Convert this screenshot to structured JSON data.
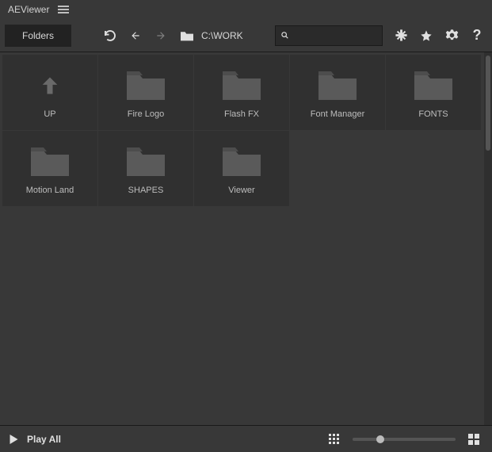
{
  "title": "AEViewer",
  "toolbar": {
    "folders_label": "Folders",
    "path": "C:\\WORK",
    "search_placeholder": ""
  },
  "items": [
    {
      "type": "up",
      "label": "UP"
    },
    {
      "type": "folder",
      "label": "Fire Logo"
    },
    {
      "type": "folder",
      "label": "Flash FX"
    },
    {
      "type": "folder",
      "label": "Font Manager"
    },
    {
      "type": "folder",
      "label": "FONTS"
    },
    {
      "type": "folder",
      "label": "Motion Land"
    },
    {
      "type": "folder",
      "label": "SHAPES"
    },
    {
      "type": "folder",
      "label": "Viewer"
    }
  ],
  "footer": {
    "play_all": "Play All"
  }
}
